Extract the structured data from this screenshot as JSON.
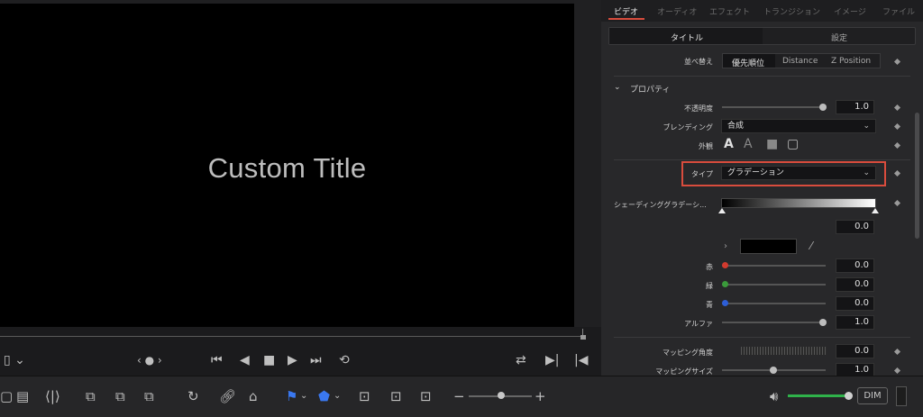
{
  "viewer": {
    "title_text": "Custom Title"
  },
  "transport": {
    "nav_dots": "‹ ● ›"
  },
  "inspector": {
    "tabs": [
      "ビデオ",
      "オーディオ",
      "エフェクト",
      "トランジション",
      "イメージ",
      "ファイル"
    ],
    "active_tab": "ビデオ",
    "subtabs": [
      "タイトル",
      "設定"
    ],
    "sort": {
      "label": "並べ替え",
      "options": [
        "優先順位",
        "Distance",
        "Z Position"
      ],
      "selected": "優先順位"
    },
    "properties_header": "プロパティ",
    "opacity": {
      "label": "不透明度",
      "value": "1.0",
      "level": 1.0
    },
    "blending": {
      "label": "ブレンディング",
      "value": "合成"
    },
    "appearance": {
      "label": "外観"
    },
    "type": {
      "label": "タイプ",
      "value": "グラデーション"
    },
    "shading": {
      "label": "シェーディンググラデーシ...",
      "stop_value": "0.0"
    },
    "color": {
      "red": {
        "label": "赤",
        "value": "0.0",
        "level": 0.0
      },
      "green": {
        "label": "緑",
        "value": "0.0",
        "level": 0.0
      },
      "blue": {
        "label": "青",
        "value": "0.0",
        "level": 0.0
      },
      "alpha": {
        "label": "アルファ",
        "value": "1.0",
        "level": 1.0
      }
    },
    "mapping_angle": {
      "label": "マッピング角度",
      "value": "0.0"
    },
    "mapping_size": {
      "label": "マッピングサイズ",
      "value": "1.0"
    }
  },
  "toolbar": {
    "dim_label": "DIM",
    "volume_level": 1.0
  },
  "colors": {
    "accent_red": "#d94c3d",
    "volume_green": "#2fb24a",
    "flag_blue": "#3a78f0",
    "red_dot": "#d23a2e",
    "green_dot": "#3a9a3a",
    "blue_dot": "#2d5ed6"
  }
}
